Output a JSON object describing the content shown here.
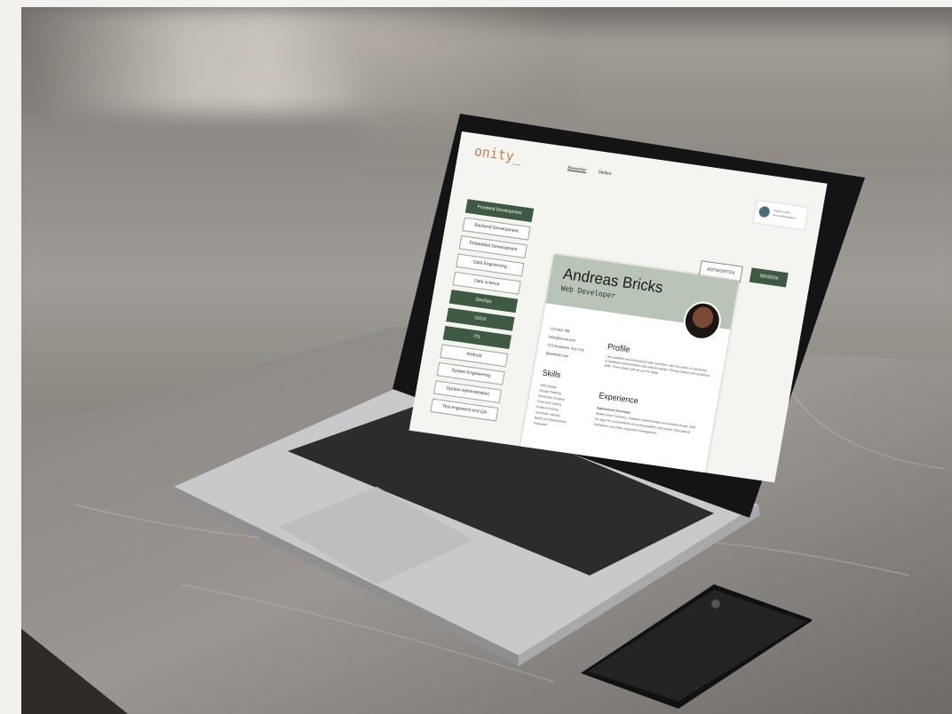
{
  "site": {
    "logo": "onity_",
    "nav": [
      "Bewerber",
      "Stellen"
    ],
    "user": {
      "name": "Angela Leclerc",
      "role": "Personalmanagerin"
    }
  },
  "sidebar": {
    "items": [
      {
        "label": "Frontend Development",
        "selected": true
      },
      {
        "label": "Backend Development",
        "selected": false
      },
      {
        "label": "Embedded Development",
        "selected": false
      },
      {
        "label": "Data Engineering",
        "selected": false
      },
      {
        "label": "Data science",
        "selected": false
      },
      {
        "label": "DevOps",
        "selected": true
      },
      {
        "label": "UI/UX",
        "selected": true
      },
      {
        "label": "ITIL",
        "selected": true
      },
      {
        "label": "Android",
        "selected": false
      },
      {
        "label": "System Engineering",
        "selected": false
      },
      {
        "label": "System Administration",
        "selected": false
      },
      {
        "label": "Test engineers and QA",
        "selected": false
      }
    ]
  },
  "actions": {
    "answer": "ANTWORTEN",
    "send": "SENDEN"
  },
  "cv": {
    "name": "Andreas Bricks",
    "role": "Web Developer",
    "contact": [
      "123 456 789",
      "hello@email.com",
      "123 Anywhere, Any City",
      "@website.com"
    ],
    "profile_heading": "Profile",
    "profile_text": "I am qualified and professional web developer with five years of experience in database administration and website design. Strong creative and analytical skills. Team player with an eye for detail.",
    "skills_heading": "Skills",
    "skills": [
      "Web Design",
      "Design Thinking",
      "Wireframe Creation",
      "Front End Coding",
      "Problem-Solving",
      "Computer Literacy",
      "Back End Development",
      "Teamwork"
    ],
    "experience_heading": "Experience",
    "experience_title": "Applications Developer",
    "experience_text": "Really Great Company. Database administration and website design. Built the logic for a streamlined ad-serving platform that scaled. Educational institutions and online classroom management."
  }
}
